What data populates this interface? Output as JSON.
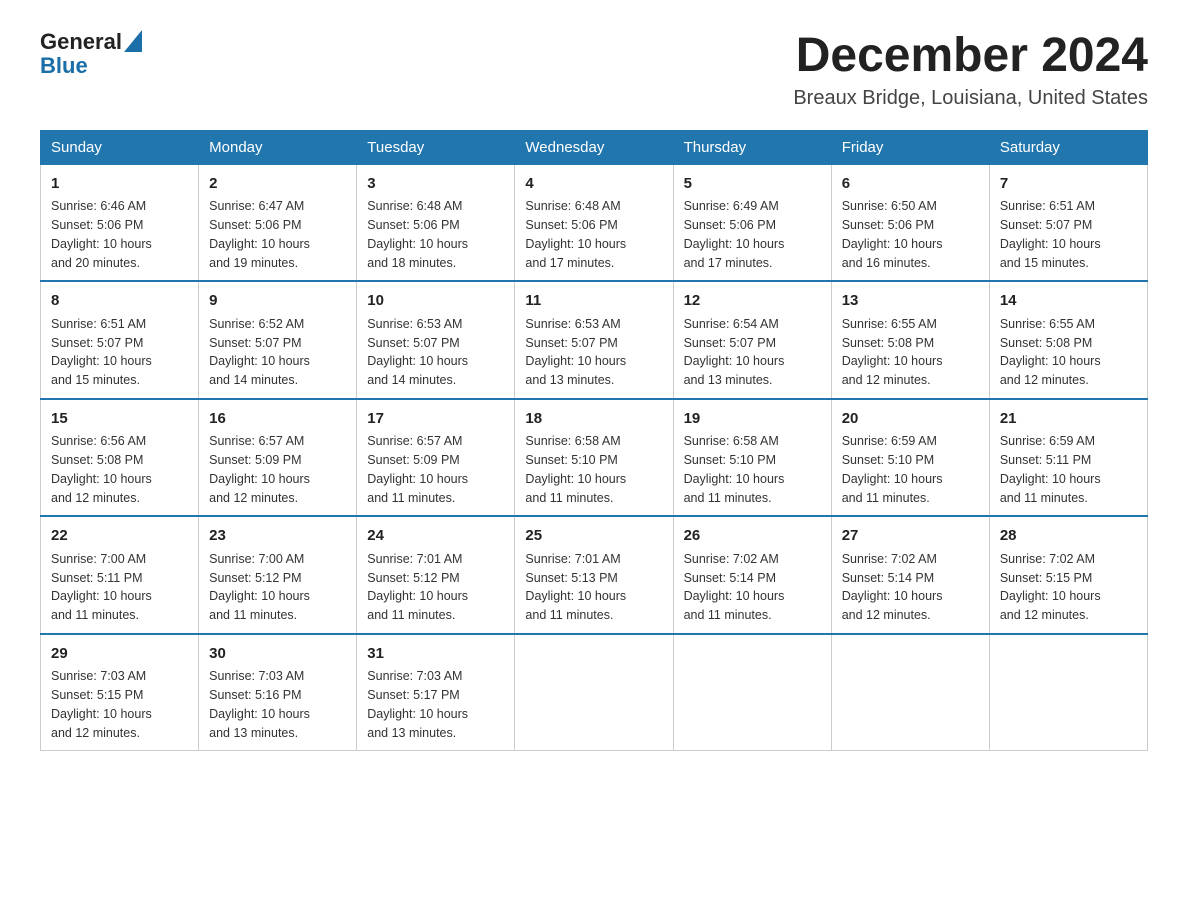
{
  "header": {
    "logo_general": "General",
    "logo_blue": "Blue",
    "title": "December 2024",
    "subtitle": "Breaux Bridge, Louisiana, United States"
  },
  "days_of_week": [
    "Sunday",
    "Monday",
    "Tuesday",
    "Wednesday",
    "Thursday",
    "Friday",
    "Saturday"
  ],
  "weeks": [
    [
      {
        "day": "1",
        "sunrise": "6:46 AM",
        "sunset": "5:06 PM",
        "daylight": "10 hours and 20 minutes."
      },
      {
        "day": "2",
        "sunrise": "6:47 AM",
        "sunset": "5:06 PM",
        "daylight": "10 hours and 19 minutes."
      },
      {
        "day": "3",
        "sunrise": "6:48 AM",
        "sunset": "5:06 PM",
        "daylight": "10 hours and 18 minutes."
      },
      {
        "day": "4",
        "sunrise": "6:48 AM",
        "sunset": "5:06 PM",
        "daylight": "10 hours and 17 minutes."
      },
      {
        "day": "5",
        "sunrise": "6:49 AM",
        "sunset": "5:06 PM",
        "daylight": "10 hours and 17 minutes."
      },
      {
        "day": "6",
        "sunrise": "6:50 AM",
        "sunset": "5:06 PM",
        "daylight": "10 hours and 16 minutes."
      },
      {
        "day": "7",
        "sunrise": "6:51 AM",
        "sunset": "5:07 PM",
        "daylight": "10 hours and 15 minutes."
      }
    ],
    [
      {
        "day": "8",
        "sunrise": "6:51 AM",
        "sunset": "5:07 PM",
        "daylight": "10 hours and 15 minutes."
      },
      {
        "day": "9",
        "sunrise": "6:52 AM",
        "sunset": "5:07 PM",
        "daylight": "10 hours and 14 minutes."
      },
      {
        "day": "10",
        "sunrise": "6:53 AM",
        "sunset": "5:07 PM",
        "daylight": "10 hours and 14 minutes."
      },
      {
        "day": "11",
        "sunrise": "6:53 AM",
        "sunset": "5:07 PM",
        "daylight": "10 hours and 13 minutes."
      },
      {
        "day": "12",
        "sunrise": "6:54 AM",
        "sunset": "5:07 PM",
        "daylight": "10 hours and 13 minutes."
      },
      {
        "day": "13",
        "sunrise": "6:55 AM",
        "sunset": "5:08 PM",
        "daylight": "10 hours and 12 minutes."
      },
      {
        "day": "14",
        "sunrise": "6:55 AM",
        "sunset": "5:08 PM",
        "daylight": "10 hours and 12 minutes."
      }
    ],
    [
      {
        "day": "15",
        "sunrise": "6:56 AM",
        "sunset": "5:08 PM",
        "daylight": "10 hours and 12 minutes."
      },
      {
        "day": "16",
        "sunrise": "6:57 AM",
        "sunset": "5:09 PM",
        "daylight": "10 hours and 12 minutes."
      },
      {
        "day": "17",
        "sunrise": "6:57 AM",
        "sunset": "5:09 PM",
        "daylight": "10 hours and 11 minutes."
      },
      {
        "day": "18",
        "sunrise": "6:58 AM",
        "sunset": "5:10 PM",
        "daylight": "10 hours and 11 minutes."
      },
      {
        "day": "19",
        "sunrise": "6:58 AM",
        "sunset": "5:10 PM",
        "daylight": "10 hours and 11 minutes."
      },
      {
        "day": "20",
        "sunrise": "6:59 AM",
        "sunset": "5:10 PM",
        "daylight": "10 hours and 11 minutes."
      },
      {
        "day": "21",
        "sunrise": "6:59 AM",
        "sunset": "5:11 PM",
        "daylight": "10 hours and 11 minutes."
      }
    ],
    [
      {
        "day": "22",
        "sunrise": "7:00 AM",
        "sunset": "5:11 PM",
        "daylight": "10 hours and 11 minutes."
      },
      {
        "day": "23",
        "sunrise": "7:00 AM",
        "sunset": "5:12 PM",
        "daylight": "10 hours and 11 minutes."
      },
      {
        "day": "24",
        "sunrise": "7:01 AM",
        "sunset": "5:12 PM",
        "daylight": "10 hours and 11 minutes."
      },
      {
        "day": "25",
        "sunrise": "7:01 AM",
        "sunset": "5:13 PM",
        "daylight": "10 hours and 11 minutes."
      },
      {
        "day": "26",
        "sunrise": "7:02 AM",
        "sunset": "5:14 PM",
        "daylight": "10 hours and 11 minutes."
      },
      {
        "day": "27",
        "sunrise": "7:02 AM",
        "sunset": "5:14 PM",
        "daylight": "10 hours and 12 minutes."
      },
      {
        "day": "28",
        "sunrise": "7:02 AM",
        "sunset": "5:15 PM",
        "daylight": "10 hours and 12 minutes."
      }
    ],
    [
      {
        "day": "29",
        "sunrise": "7:03 AM",
        "sunset": "5:15 PM",
        "daylight": "10 hours and 12 minutes."
      },
      {
        "day": "30",
        "sunrise": "7:03 AM",
        "sunset": "5:16 PM",
        "daylight": "10 hours and 13 minutes."
      },
      {
        "day": "31",
        "sunrise": "7:03 AM",
        "sunset": "5:17 PM",
        "daylight": "10 hours and 13 minutes."
      },
      null,
      null,
      null,
      null
    ]
  ],
  "labels": {
    "sunrise": "Sunrise:",
    "sunset": "Sunset:",
    "daylight": "Daylight:"
  }
}
